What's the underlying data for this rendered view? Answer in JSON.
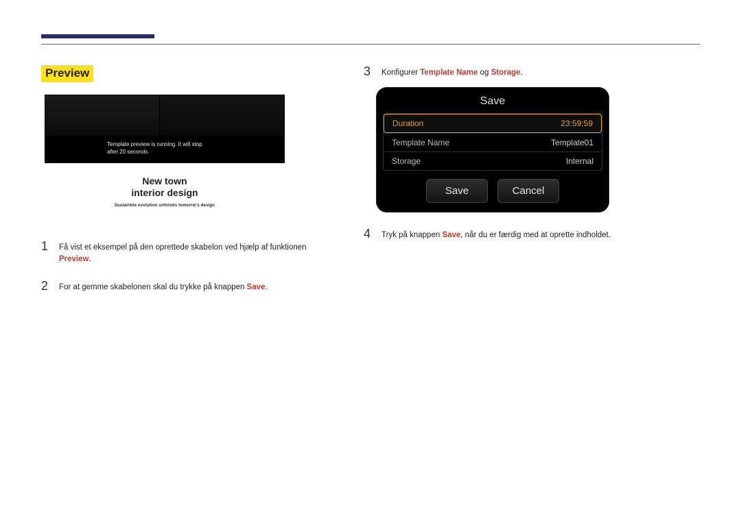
{
  "section_title": "Preview",
  "preview_mock": {
    "banner_line1": "Template preview is running. It will stop",
    "banner_line2": "after 20 seconds.",
    "headline1": "New town",
    "headline2": "interior design",
    "sub": "Sustainble evolution unfolods tomorrw's design"
  },
  "steps_left": {
    "s1": {
      "num": "1",
      "pre": "Få vist et eksempel på den oprettede skabelon ved hjælp af funktionen ",
      "hl": "Preview",
      "post": "."
    },
    "s2": {
      "num": "2",
      "pre": "For at gemme skabelonen skal du trykke på knappen ",
      "hl": "Save",
      "post": "."
    }
  },
  "steps_right": {
    "s3": {
      "num": "3",
      "pre": "Konfigurer ",
      "hl1": "Template Name",
      "mid": " og ",
      "hl2": "Storage",
      "post": "."
    },
    "s4": {
      "num": "4",
      "pre": "Tryk på knappen ",
      "hl": "Save",
      "post": ", når du er færdig med at oprette indholdet."
    }
  },
  "save_dialog": {
    "title": "Save",
    "rows": {
      "duration": {
        "label": "Duration",
        "value": "23:59:59"
      },
      "template_name": {
        "label": "Template Name",
        "value": "Template01"
      },
      "storage": {
        "label": "Storage",
        "value": "Internal"
      }
    },
    "save_btn": "Save",
    "cancel_btn": "Cancel"
  }
}
